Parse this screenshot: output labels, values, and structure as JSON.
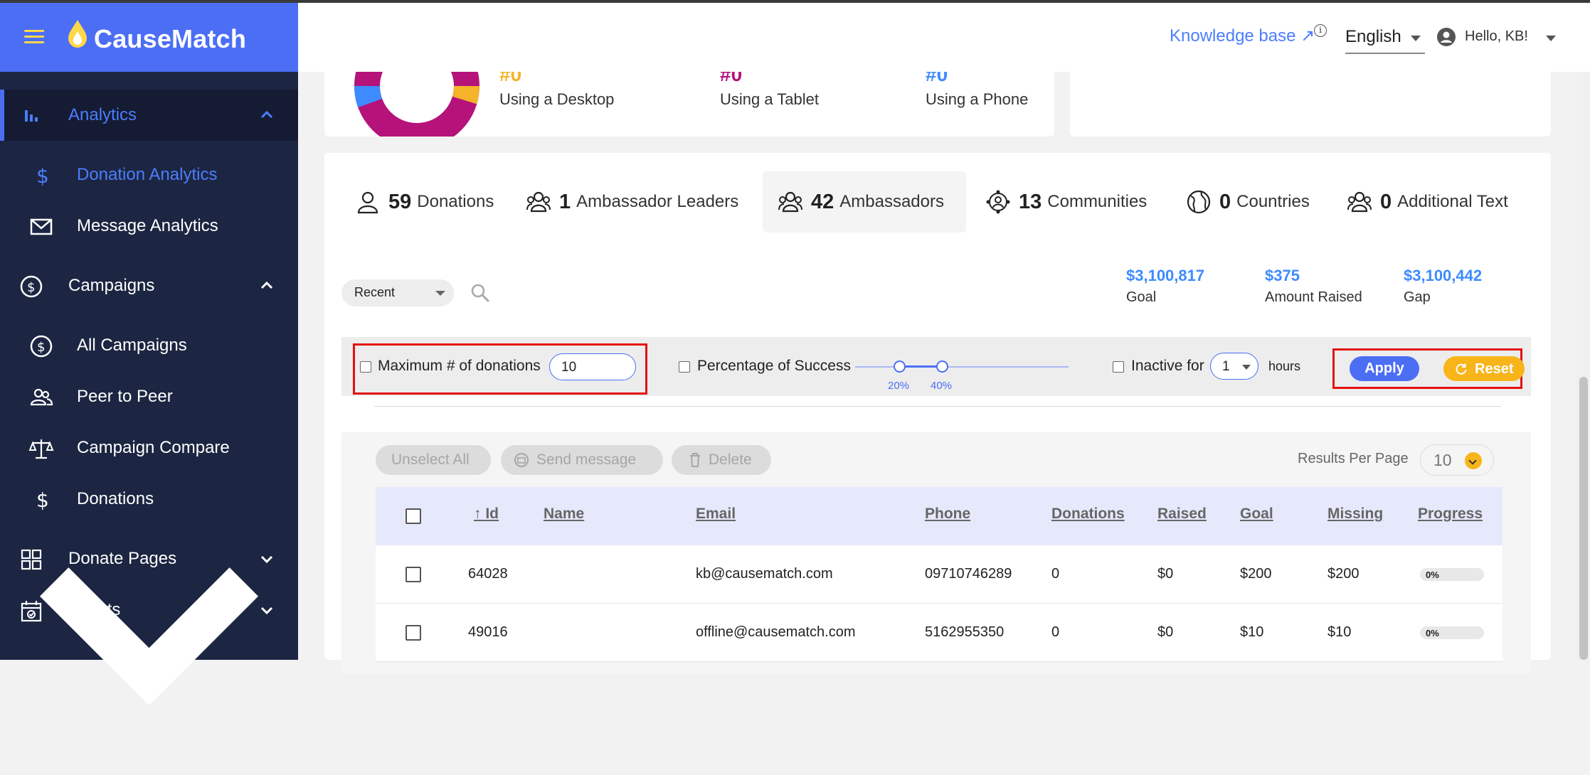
{
  "brand": {
    "name": "CauseMatch"
  },
  "sidebar": {
    "items": [
      {
        "label": "Analytics",
        "icon": "bar-chart-icon",
        "expanded": true
      },
      {
        "label": "Donation Analytics",
        "icon": "dollar-icon"
      },
      {
        "label": "Message Analytics",
        "icon": "envelope-icon"
      },
      {
        "label": "Campaigns",
        "icon": "dollar-circle-icon",
        "expanded": true
      },
      {
        "label": "All Campaigns",
        "icon": "dollar-circle-icon"
      },
      {
        "label": "Peer to Peer",
        "icon": "users-icon"
      },
      {
        "label": "Campaign Compare",
        "icon": "scale-icon"
      },
      {
        "label": "Donations",
        "icon": "dollar-icon",
        "expanded": false
      },
      {
        "label": "Donate Pages",
        "icon": "grid-icon",
        "expanded": false
      },
      {
        "label": "Events",
        "icon": "calendar-icon",
        "expanded": false
      }
    ]
  },
  "header": {
    "knowledge_base": "Knowledge base ↗",
    "info_mark": "i",
    "language": "English",
    "greeting": "Hello, KB!"
  },
  "devices": [
    {
      "num": "#0",
      "label": "Using a Desktop",
      "color": "#f5b32a"
    },
    {
      "num": "#0",
      "label": "Using a Tablet",
      "color": "#b5127a"
    },
    {
      "num": "#0",
      "label": "Using a Phone",
      "color": "#3d8bff"
    }
  ],
  "tabs": [
    {
      "count": "59",
      "label": "Donations",
      "icon": "person-icon"
    },
    {
      "count": "1",
      "label": "Ambassador Leaders",
      "icon": "group-icon"
    },
    {
      "count": "42",
      "label": "Ambassadors",
      "icon": "group-icon",
      "active": true
    },
    {
      "count": "13",
      "label": "Communities",
      "icon": "community-icon"
    },
    {
      "count": "0",
      "label": "Countries",
      "icon": "globe-icon"
    },
    {
      "count": "0",
      "label": "Additional Text",
      "icon": "group-icon"
    }
  ],
  "sort": {
    "value": "Recent"
  },
  "stats": [
    {
      "value": "$3,100,817",
      "label": "Goal"
    },
    {
      "value": "$375",
      "label": "Amount Raised"
    },
    {
      "value": "$3,100,442",
      "label": "Gap"
    }
  ],
  "filters": {
    "max_donations_label": "Maximum # of donations",
    "max_donations_value": "10",
    "percentage_label": "Percentage of Success",
    "slider_low": "20%",
    "slider_high": "40%",
    "inactive_label": "Inactive for",
    "inactive_value": "1",
    "hours_label": "hours",
    "apply": "Apply",
    "reset": "Reset"
  },
  "actions": {
    "unselect_all": "Unselect All",
    "send_message": "Send message",
    "delete": "Delete",
    "results_per_page_label": "Results Per Page",
    "results_per_page": "10"
  },
  "table": {
    "columns": [
      "↑ Id",
      "Name",
      "Email",
      "Phone",
      "Donations",
      "Raised",
      "Goal",
      "Missing",
      "Progress"
    ],
    "rows": [
      {
        "id": "64028",
        "name": "",
        "email": "kb@causematch.com",
        "phone": "09710746289",
        "donations": "0",
        "raised": "$0",
        "goal": "$200",
        "missing": "$200",
        "progress": "0%"
      },
      {
        "id": "49016",
        "name": "",
        "email": "offline@causematch.com",
        "phone": "5162955350",
        "donations": "0",
        "raised": "$0",
        "goal": "$10",
        "missing": "$10",
        "progress": "0%"
      }
    ]
  },
  "colors": {
    "accent": "#4c6ef5",
    "sidebar": "#1c2642",
    "highlight": "#e41010",
    "reset": "#f7b51a"
  }
}
